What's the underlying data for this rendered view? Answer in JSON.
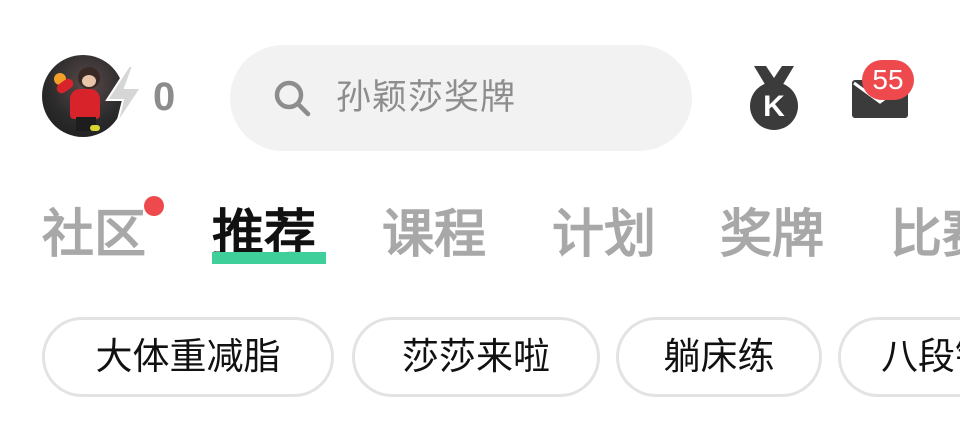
{
  "header": {
    "energy_count": "0",
    "search": {
      "placeholder": "孙颖莎奖牌"
    },
    "medal_letter": "K",
    "mail_badge_count": "55"
  },
  "tabs": [
    {
      "label": "社区",
      "active": false,
      "has_dot": true
    },
    {
      "label": "推荐",
      "active": true
    },
    {
      "label": "课程",
      "active": false
    },
    {
      "label": "计划",
      "active": false
    },
    {
      "label": "奖牌",
      "active": false
    },
    {
      "label": "比赛",
      "active": false
    }
  ],
  "chips": [
    {
      "label": "大体重减脂"
    },
    {
      "label": "莎莎来啦"
    },
    {
      "label": "躺床练"
    },
    {
      "label": "八段锦"
    }
  ],
  "colors": {
    "accent_green": "#3fcf9a",
    "badge_red": "#ee4a4e",
    "inactive_text": "#a8a8a8",
    "active_text": "#111111",
    "search_bg": "#f2f2f2"
  }
}
